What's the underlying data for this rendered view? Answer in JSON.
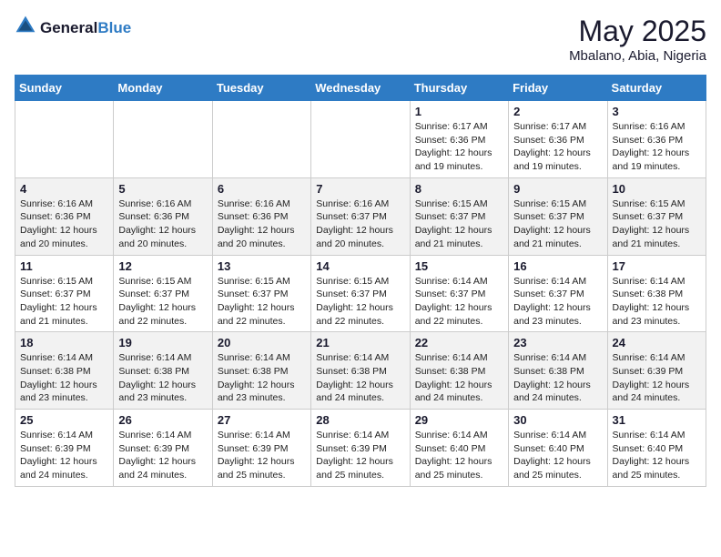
{
  "logo": {
    "text_general": "General",
    "text_blue": "Blue"
  },
  "header": {
    "month_year": "May 2025",
    "location": "Mbalano, Abia, Nigeria"
  },
  "days_of_week": [
    "Sunday",
    "Monday",
    "Tuesday",
    "Wednesday",
    "Thursday",
    "Friday",
    "Saturday"
  ],
  "weeks": [
    [
      {
        "day": "",
        "sunrise": "",
        "sunset": "",
        "daylight": ""
      },
      {
        "day": "",
        "sunrise": "",
        "sunset": "",
        "daylight": ""
      },
      {
        "day": "",
        "sunrise": "",
        "sunset": "",
        "daylight": ""
      },
      {
        "day": "",
        "sunrise": "",
        "sunset": "",
        "daylight": ""
      },
      {
        "day": "1",
        "sunrise": "Sunrise: 6:17 AM",
        "sunset": "Sunset: 6:36 PM",
        "daylight": "Daylight: 12 hours and 19 minutes."
      },
      {
        "day": "2",
        "sunrise": "Sunrise: 6:17 AM",
        "sunset": "Sunset: 6:36 PM",
        "daylight": "Daylight: 12 hours and 19 minutes."
      },
      {
        "day": "3",
        "sunrise": "Sunrise: 6:16 AM",
        "sunset": "Sunset: 6:36 PM",
        "daylight": "Daylight: 12 hours and 19 minutes."
      }
    ],
    [
      {
        "day": "4",
        "sunrise": "Sunrise: 6:16 AM",
        "sunset": "Sunset: 6:36 PM",
        "daylight": "Daylight: 12 hours and 20 minutes."
      },
      {
        "day": "5",
        "sunrise": "Sunrise: 6:16 AM",
        "sunset": "Sunset: 6:36 PM",
        "daylight": "Daylight: 12 hours and 20 minutes."
      },
      {
        "day": "6",
        "sunrise": "Sunrise: 6:16 AM",
        "sunset": "Sunset: 6:36 PM",
        "daylight": "Daylight: 12 hours and 20 minutes."
      },
      {
        "day": "7",
        "sunrise": "Sunrise: 6:16 AM",
        "sunset": "Sunset: 6:37 PM",
        "daylight": "Daylight: 12 hours and 20 minutes."
      },
      {
        "day": "8",
        "sunrise": "Sunrise: 6:15 AM",
        "sunset": "Sunset: 6:37 PM",
        "daylight": "Daylight: 12 hours and 21 minutes."
      },
      {
        "day": "9",
        "sunrise": "Sunrise: 6:15 AM",
        "sunset": "Sunset: 6:37 PM",
        "daylight": "Daylight: 12 hours and 21 minutes."
      },
      {
        "day": "10",
        "sunrise": "Sunrise: 6:15 AM",
        "sunset": "Sunset: 6:37 PM",
        "daylight": "Daylight: 12 hours and 21 minutes."
      }
    ],
    [
      {
        "day": "11",
        "sunrise": "Sunrise: 6:15 AM",
        "sunset": "Sunset: 6:37 PM",
        "daylight": "Daylight: 12 hours and 21 minutes."
      },
      {
        "day": "12",
        "sunrise": "Sunrise: 6:15 AM",
        "sunset": "Sunset: 6:37 PM",
        "daylight": "Daylight: 12 hours and 22 minutes."
      },
      {
        "day": "13",
        "sunrise": "Sunrise: 6:15 AM",
        "sunset": "Sunset: 6:37 PM",
        "daylight": "Daylight: 12 hours and 22 minutes."
      },
      {
        "day": "14",
        "sunrise": "Sunrise: 6:15 AM",
        "sunset": "Sunset: 6:37 PM",
        "daylight": "Daylight: 12 hours and 22 minutes."
      },
      {
        "day": "15",
        "sunrise": "Sunrise: 6:14 AM",
        "sunset": "Sunset: 6:37 PM",
        "daylight": "Daylight: 12 hours and 22 minutes."
      },
      {
        "day": "16",
        "sunrise": "Sunrise: 6:14 AM",
        "sunset": "Sunset: 6:37 PM",
        "daylight": "Daylight: 12 hours and 23 minutes."
      },
      {
        "day": "17",
        "sunrise": "Sunrise: 6:14 AM",
        "sunset": "Sunset: 6:38 PM",
        "daylight": "Daylight: 12 hours and 23 minutes."
      }
    ],
    [
      {
        "day": "18",
        "sunrise": "Sunrise: 6:14 AM",
        "sunset": "Sunset: 6:38 PM",
        "daylight": "Daylight: 12 hours and 23 minutes."
      },
      {
        "day": "19",
        "sunrise": "Sunrise: 6:14 AM",
        "sunset": "Sunset: 6:38 PM",
        "daylight": "Daylight: 12 hours and 23 minutes."
      },
      {
        "day": "20",
        "sunrise": "Sunrise: 6:14 AM",
        "sunset": "Sunset: 6:38 PM",
        "daylight": "Daylight: 12 hours and 23 minutes."
      },
      {
        "day": "21",
        "sunrise": "Sunrise: 6:14 AM",
        "sunset": "Sunset: 6:38 PM",
        "daylight": "Daylight: 12 hours and 24 minutes."
      },
      {
        "day": "22",
        "sunrise": "Sunrise: 6:14 AM",
        "sunset": "Sunset: 6:38 PM",
        "daylight": "Daylight: 12 hours and 24 minutes."
      },
      {
        "day": "23",
        "sunrise": "Sunrise: 6:14 AM",
        "sunset": "Sunset: 6:38 PM",
        "daylight": "Daylight: 12 hours and 24 minutes."
      },
      {
        "day": "24",
        "sunrise": "Sunrise: 6:14 AM",
        "sunset": "Sunset: 6:39 PM",
        "daylight": "Daylight: 12 hours and 24 minutes."
      }
    ],
    [
      {
        "day": "25",
        "sunrise": "Sunrise: 6:14 AM",
        "sunset": "Sunset: 6:39 PM",
        "daylight": "Daylight: 12 hours and 24 minutes."
      },
      {
        "day": "26",
        "sunrise": "Sunrise: 6:14 AM",
        "sunset": "Sunset: 6:39 PM",
        "daylight": "Daylight: 12 hours and 24 minutes."
      },
      {
        "day": "27",
        "sunrise": "Sunrise: 6:14 AM",
        "sunset": "Sunset: 6:39 PM",
        "daylight": "Daylight: 12 hours and 25 minutes."
      },
      {
        "day": "28",
        "sunrise": "Sunrise: 6:14 AM",
        "sunset": "Sunset: 6:39 PM",
        "daylight": "Daylight: 12 hours and 25 minutes."
      },
      {
        "day": "29",
        "sunrise": "Sunrise: 6:14 AM",
        "sunset": "Sunset: 6:40 PM",
        "daylight": "Daylight: 12 hours and 25 minutes."
      },
      {
        "day": "30",
        "sunrise": "Sunrise: 6:14 AM",
        "sunset": "Sunset: 6:40 PM",
        "daylight": "Daylight: 12 hours and 25 minutes."
      },
      {
        "day": "31",
        "sunrise": "Sunrise: 6:14 AM",
        "sunset": "Sunset: 6:40 PM",
        "daylight": "Daylight: 12 hours and 25 minutes."
      }
    ]
  ]
}
